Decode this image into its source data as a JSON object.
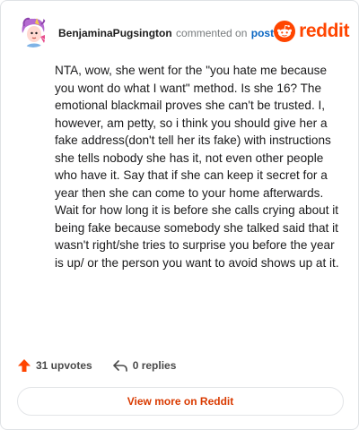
{
  "comment": {
    "author": "BenjaminaPugsington",
    "action_text": "commented on",
    "post_link": "post",
    "body": "NTA, wow, she went for the \"you hate me because you wont do what I want\" method. Is she 16? The emotional blackmail proves she can't be trusted. I, however, am petty, so i think you should give her a fake address(don't tell her its fake) with instructions she tells nobody she has it, not even other people who have it. Say that if she can keep it secret for a year then she can come to your home afterwards. Wait for how long it is before she calls crying about it being fake because somebody she talked said that it wasn't right/she tries to surprise you before the year is up/ or the person you want to avoid shows up at it."
  },
  "brand": {
    "name": "reddit",
    "color": "#ff4500",
    "icon": "reddit-alien-icon"
  },
  "actions": {
    "upvotes": "31 upvotes",
    "replies": "0 replies"
  },
  "footer": {
    "view_more": "View more on Reddit"
  },
  "colors": {
    "upvote": "#ff4500",
    "link": "#0a66c2",
    "view_more": "#d93a00"
  }
}
